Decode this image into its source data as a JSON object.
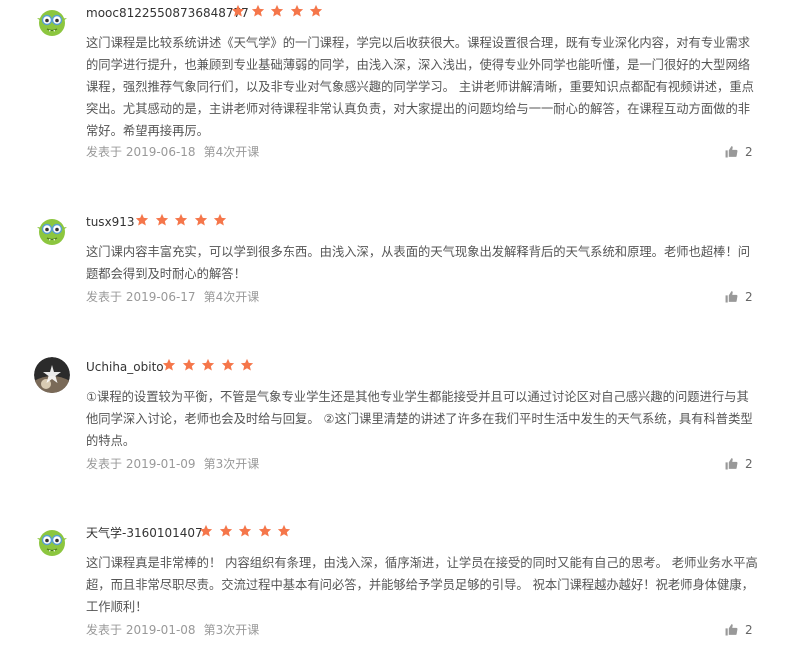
{
  "reviews": [
    {
      "avatar": "green-goblin-avatar",
      "user": "mooc81225508736848777",
      "rating": 5,
      "content": "这门课程是比较系统讲述《天气学》的一门课程，学完以后收获很大。课程设置很合理，既有专业深化内容，对有专业需求的同学进行提升，也兼顾到专业基础薄弱的同学，由浅入深，深入浅出，使得专业外同学也能听懂，是一门很好的大型网络课程，强烈推荐气象同行们，以及非专业对气象感兴趣的同学学习。 主讲老师讲解清晰，重要知识点都配有视频讲述，重点突出。尤其感动的是，主讲老师对待课程非常认真负责，对大家提出的问题均给与一一耐心的解答，在课程互动方面做的非常好。希望再接再厉。",
      "date": "发表于 2019-06-18",
      "term": "第4次开课",
      "likes": "2"
    },
    {
      "avatar": "green-goblin-avatar",
      "user": "tusx913",
      "rating": 5,
      "content": "这门课内容丰富充实，可以学到很多东西。由浅入深，从表面的天气现象出发解释背后的天气系统和原理。老师也超棒！问题都会得到及时耐心的解答！",
      "date": "发表于 2019-06-17",
      "term": "第4次开课",
      "likes": "2"
    },
    {
      "avatar": "photo-avatar",
      "user": "Uchiha_obito",
      "rating": 5,
      "content": "①课程的设置较为平衡，不管是气象专业学生还是其他专业学生都能接受并且可以通过讨论区对自己感兴趣的问题进行与其他同学深入讨论，老师也会及时给与回复。 ②这门课里清楚的讲述了许多在我们平时生活中发生的天气系统，具有科普类型的特点。",
      "date": "发表于 2019-01-09",
      "term": "第3次开课",
      "likes": "2"
    },
    {
      "avatar": "green-goblin-avatar",
      "user": "天气学-3160101407",
      "rating": 5,
      "content": "这门课程真是非常棒的！ 内容组织有条理，由浅入深，循序渐进，让学员在接受的同时又能有自己的思考。 老师业务水平高超，而且非常尽职尽责。交流过程中基本有问必答，并能够给予学员足够的引导。 祝本门课程越办越好！祝老师身体健康，工作顺利！",
      "date": "发表于 2019-01-08",
      "term": "第3次开课",
      "likes": "2"
    }
  ],
  "colors": {
    "star": "#f5764a",
    "text": "#555555",
    "meta": "#999999",
    "thumb": "#999999"
  }
}
